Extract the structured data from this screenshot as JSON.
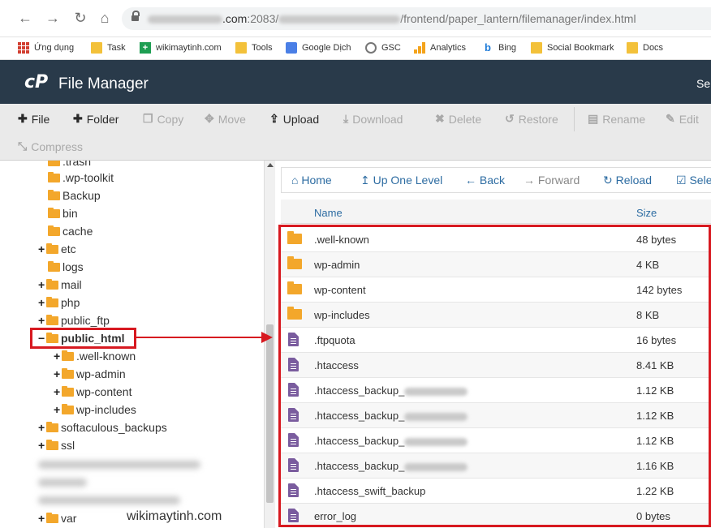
{
  "browser": {
    "url_host_suffix": ".com",
    "url_port": ":2083/",
    "url_path": "/frontend/paper_lantern/filemanager/index.html"
  },
  "bookmarks": [
    {
      "label": "Ứng dụng",
      "icon": "apps-icon"
    },
    {
      "label": "Task",
      "icon": "folder-icon"
    },
    {
      "label": "wikimaytinh.com",
      "icon": "site-icon"
    },
    {
      "label": "Tools",
      "icon": "folder-icon"
    },
    {
      "label": "Google Dịch",
      "icon": "translate-icon"
    },
    {
      "label": "GSC",
      "icon": "gsc-icon"
    },
    {
      "label": "Analytics",
      "icon": "analytics-icon"
    },
    {
      "label": "Bing",
      "icon": "bing-icon"
    },
    {
      "label": "Social Bookmark",
      "icon": "folder-icon"
    },
    {
      "label": "Docs",
      "icon": "folder-icon"
    }
  ],
  "header": {
    "logo": "cP",
    "title": "File Manager",
    "right_text": "Se"
  },
  "toolbar": {
    "file": "File",
    "folder": "Folder",
    "copy": "Copy",
    "move": "Move",
    "upload": "Upload",
    "download": "Download",
    "delete": "Delete",
    "restore": "Restore",
    "rename": "Rename",
    "edit": "Edit",
    "compress": "Compress"
  },
  "tree": [
    {
      "label": ".trash",
      "prefix": ""
    },
    {
      "label": ".wp-toolkit",
      "prefix": ""
    },
    {
      "label": "Backup",
      "prefix": ""
    },
    {
      "label": "bin",
      "prefix": ""
    },
    {
      "label": "cache",
      "prefix": ""
    },
    {
      "label": "etc",
      "prefix": "+"
    },
    {
      "label": "logs",
      "prefix": ""
    },
    {
      "label": "mail",
      "prefix": "+"
    },
    {
      "label": "php",
      "prefix": "+"
    },
    {
      "label": "public_ftp",
      "prefix": "+"
    },
    {
      "label": "public_html",
      "prefix": "−"
    },
    {
      "label": ".well-known",
      "prefix": "+"
    },
    {
      "label": "wp-admin",
      "prefix": "+"
    },
    {
      "label": "wp-content",
      "prefix": "+"
    },
    {
      "label": "wp-includes",
      "prefix": "+"
    },
    {
      "label": "softaculous_backups",
      "prefix": "+"
    },
    {
      "label": "ssl",
      "prefix": "+"
    },
    {
      "label": "var",
      "prefix": "+"
    }
  ],
  "watermark": "wikimaytinh.com",
  "content_nav": {
    "home": "Home",
    "up": "Up One Level",
    "back": "Back",
    "forward": "Forward",
    "reload": "Reload",
    "select": "Sele"
  },
  "columns": {
    "name": "Name",
    "size": "Size"
  },
  "files": [
    {
      "name": ".well-known",
      "size": "48 bytes",
      "type": "folder"
    },
    {
      "name": "wp-admin",
      "size": "4 KB",
      "type": "folder"
    },
    {
      "name": "wp-content",
      "size": "142 bytes",
      "type": "folder"
    },
    {
      "name": "wp-includes",
      "size": "8 KB",
      "type": "folder"
    },
    {
      "name": ".ftpquota",
      "size": "16 bytes",
      "type": "file"
    },
    {
      "name": ".htaccess",
      "size": "8.41 KB",
      "type": "file"
    },
    {
      "name": ".htaccess_backup_",
      "size": "1.12 KB",
      "type": "file"
    },
    {
      "name": ".htaccess_backup_",
      "size": "1.12 KB",
      "type": "file"
    },
    {
      "name": ".htaccess_backup_",
      "size": "1.12 KB",
      "type": "file"
    },
    {
      "name": ".htaccess_backup_",
      "size": "1.16 KB",
      "type": "file"
    },
    {
      "name": ".htaccess_swift_backup",
      "size": "1.22 KB",
      "type": "file"
    },
    {
      "name": "error_log",
      "size": "0 bytes",
      "type": "file"
    }
  ],
  "colors": {
    "header_bg": "#293a4a",
    "annotation_red": "#d71920",
    "link_blue": "#2d6ca2",
    "folder": "#f3a72b",
    "file_icon": "#7a5c9e"
  }
}
